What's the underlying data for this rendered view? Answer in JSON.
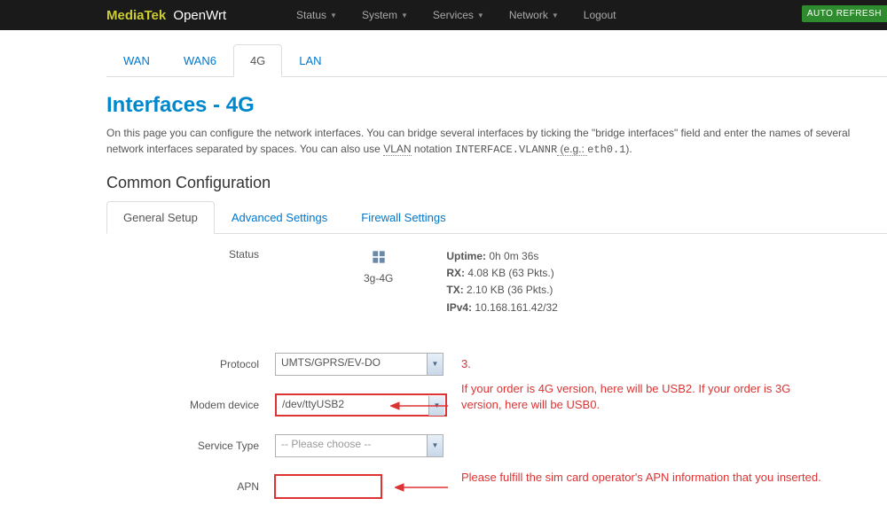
{
  "topbar": {
    "brand_highlight": "MediaTek",
    "brand_text": "OpenWrt",
    "menus": [
      {
        "label": "Status",
        "caret": true
      },
      {
        "label": "System",
        "caret": true
      },
      {
        "label": "Services",
        "caret": true
      },
      {
        "label": "Network",
        "caret": true
      },
      {
        "label": "Logout",
        "caret": false
      }
    ],
    "auto_refresh": "AUTO REFRESH"
  },
  "tabs": [
    {
      "label": "WAN",
      "active": false
    },
    {
      "label": "WAN6",
      "active": false
    },
    {
      "label": "4G",
      "active": true
    },
    {
      "label": "LAN",
      "active": false
    }
  ],
  "page": {
    "title": "Interfaces - 4G",
    "desc_pre": "On this page you can configure the network interfaces. You can bridge several interfaces by ticking the \"bridge interfaces\" field and enter the names of several network interfaces separated by spaces. You can also use ",
    "desc_abbr": "VLAN",
    "desc_mid": " notation ",
    "desc_code1": "INTERFACE.VLANNR",
    "desc_eg": " (e.g.: ",
    "desc_code2": "eth0.1",
    "desc_close": ")."
  },
  "section": {
    "title": "Common Configuration",
    "subtabs": [
      {
        "label": "General Setup",
        "active": true
      },
      {
        "label": "Advanced Settings",
        "active": false
      },
      {
        "label": "Firewall Settings",
        "active": false
      }
    ]
  },
  "status": {
    "label": "Status",
    "ifname": "3g-4G",
    "uptime_label": "Uptime:",
    "uptime_val": "0h 0m 36s",
    "rx_label": "RX:",
    "rx_val": "4.08 KB (63 Pkts.)",
    "tx_label": "TX:",
    "tx_val": "2.10 KB (36 Pkts.)",
    "ipv4_label": "IPv4:",
    "ipv4_val": "10.168.161.42/32"
  },
  "fields": {
    "protocol": {
      "label": "Protocol",
      "value": "UMTS/GPRS/EV-DO"
    },
    "modem": {
      "label": "Modem device",
      "value": "/dev/ttyUSB2"
    },
    "service": {
      "label": "Service Type",
      "placeholder": "-- Please choose --"
    },
    "apn": {
      "label": "APN",
      "value": ""
    }
  },
  "annotations": {
    "num3": "3.",
    "modem_note": "If your order is 4G version, here will be USB2. If your order is 3G version, here will be USB0.",
    "apn_note": "Please fulfill the sim card operator's APN information that you inserted."
  }
}
